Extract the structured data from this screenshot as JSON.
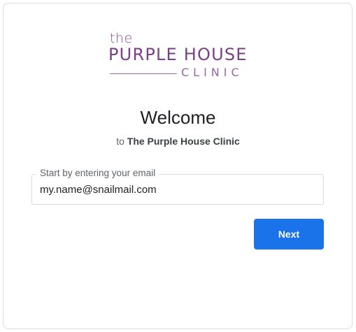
{
  "logo": {
    "the": "the",
    "name": "PURPLE HOUSE",
    "clinic": "CLINIC"
  },
  "heading": {
    "title": "Welcome",
    "prefix": "to",
    "clinic_name": "The Purple House Clinic"
  },
  "email": {
    "label": "Start by entering your email",
    "value": "my.name@snailmail.com"
  },
  "actions": {
    "next_label": "Next"
  },
  "colors": {
    "brand_purple": "#7a3f86",
    "primary_blue": "#1a73e8"
  }
}
